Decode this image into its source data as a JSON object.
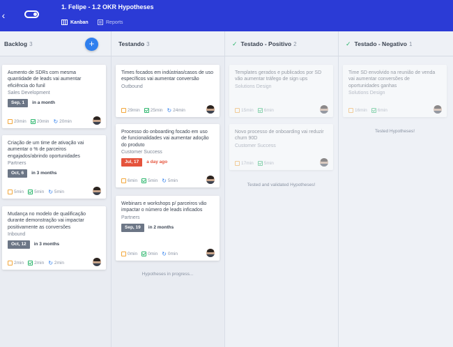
{
  "header": {
    "back_icon": "chevron-left-icon",
    "toggle_icon": "toggle-icon",
    "title": "1. Felipe - 1.2 OKR Hypotheses",
    "nav": [
      {
        "label": "Kanban",
        "icon": "kanban-icon",
        "active": true
      },
      {
        "label": "Reports",
        "icon": "reports-icon",
        "active": false
      }
    ]
  },
  "columns": [
    {
      "name": "Backlog",
      "count": "3",
      "add_label": "+",
      "cards": [
        {
          "title": "Aumento de SDRs com mesma quantidade de leads vai aumentar eficiência do funil",
          "tag": "Sales Development",
          "date": "Sep, 1",
          "relative": "in a month",
          "time": "20min",
          "done": "20min",
          "sync": "20min"
        },
        {
          "title": "Criação de um time de ativação vai aumentar o % de parceiros engajados/abrindo oportunidades",
          "tag": "Partners",
          "date": "Oct, 6",
          "relative": "in 3 months",
          "time": "5min",
          "done": "5min",
          "sync": "5min"
        },
        {
          "title": "Mudança no modelo de qualificação durante demonstração vai impactar positivamente as conversões",
          "tag": "Inbound",
          "date": "Oct, 12",
          "relative": "in 3 months",
          "time": "2min",
          "done": "2min",
          "sync": "2min"
        }
      ]
    },
    {
      "name": "Testando",
      "count": "3",
      "note": "Hypotheses in progress...",
      "cards": [
        {
          "title": "Times focados em indústrias/casos de uso específicos vai aumentar conversão",
          "tag": "Outbound",
          "time": "29min",
          "done": "25min",
          "sync": "24min"
        },
        {
          "title": "Processo do onboarding focado em uso de funcionalidades vai aumentar adoção do produto",
          "tag": "Customer Success",
          "date": "Jul, 17",
          "relative": "a day ago",
          "time": "6min",
          "done": "5min",
          "sync": "5min"
        },
        {
          "title": "Webinars e workshops p/ parceiros vão impactar o número de leads inficados",
          "tag": "Partners",
          "date": "Sep, 19",
          "relative": "in 2 months",
          "time": "0min",
          "done": "0min",
          "sync": "0min"
        }
      ]
    },
    {
      "name": "Testado - Positivo",
      "count": "2",
      "note": "Tested and validated Hypotheses!",
      "cards": [
        {
          "title": "Templates gerados e publicados por SD vão aumentar tráfego de sign ups",
          "tag": "Solutions Design",
          "time": "15min",
          "done": "6min"
        },
        {
          "title": "Novo processo de onboarding vai reduzir churn 90D",
          "tag": "Customer Success",
          "time": "17min",
          "done": "5min"
        }
      ]
    },
    {
      "name": "Testado - Negativo",
      "count": "1",
      "note": "Tested Hypotheses!",
      "cards": [
        {
          "title": "Time SD envolvido na reunião de venda vai aumentar conversões de oportunidades ganhas",
          "tag": "Solutions Design",
          "time": "16min",
          "done": "6min"
        }
      ]
    }
  ],
  "colors": {
    "header": "#2b3bd6",
    "accent": "#2f7fee",
    "late": "#e5533c",
    "check": "#2db66d"
  }
}
